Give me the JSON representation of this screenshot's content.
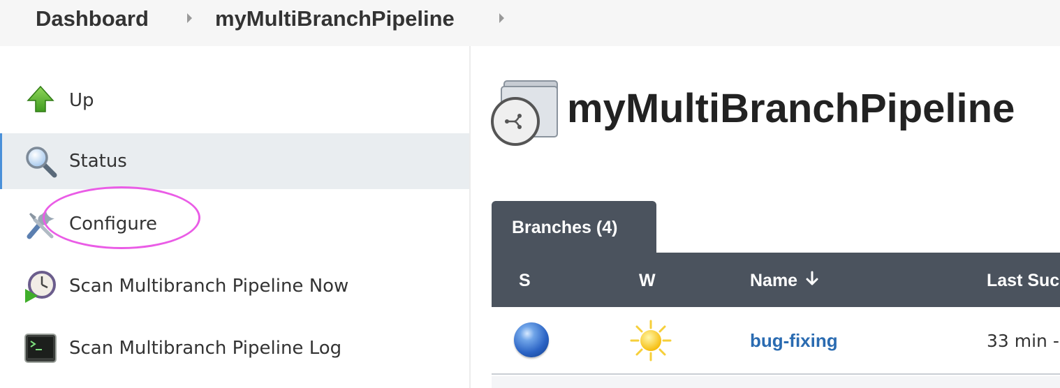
{
  "breadcrumb": {
    "items": [
      "Dashboard",
      "myMultiBranchPipeline"
    ]
  },
  "sidebar": {
    "items": [
      {
        "label": "Up",
        "icon": "up-arrow-icon"
      },
      {
        "label": "Status",
        "icon": "magnifier-icon",
        "active": true
      },
      {
        "label": "Configure",
        "icon": "wrench-screwdriver-icon",
        "highlighted": true
      },
      {
        "label": "Scan Multibranch Pipeline Now",
        "icon": "scan-clock-icon"
      },
      {
        "label": "Scan Multibranch Pipeline Log",
        "icon": "terminal-icon"
      }
    ]
  },
  "main": {
    "title": "myMultiBranchPipeline",
    "title_icon": "multibranch-folder-icon",
    "tab": {
      "label": "Branches (4)"
    },
    "table": {
      "headers": [
        "S",
        "W",
        "Name",
        "Last Suc"
      ],
      "sort_icon": "arrow-down-icon",
      "rows": [
        {
          "status": "blue-ball",
          "weather": "sunny-icon",
          "name": "bug-fixing",
          "last_success": "33 min -"
        }
      ]
    }
  },
  "colors": {
    "accent": "#4a90d9",
    "tab_bg": "#4b535e",
    "link": "#2a6bb1",
    "highlight": "#ea5ce6",
    "active_row": "#e9edf0"
  }
}
